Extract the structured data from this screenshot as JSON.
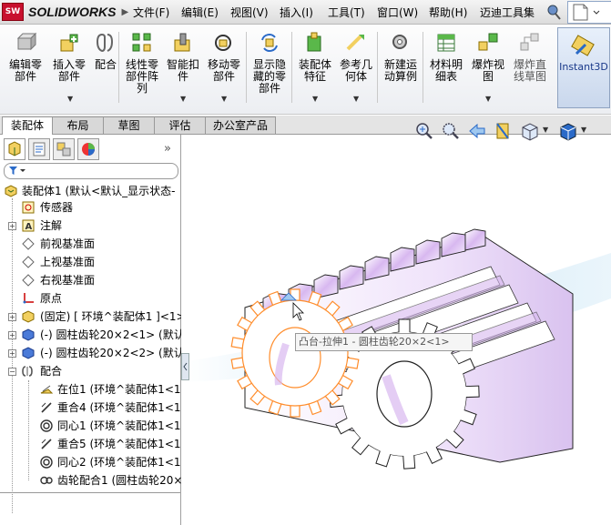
{
  "app": {
    "brand": "SOLIDWORKS",
    "brand_icon": "solidworks-logo-icon"
  },
  "menubar": {
    "items": [
      "文件(F)",
      "编辑(E)",
      "视图(V)",
      "插入(I)",
      "工具(T)",
      "窗口(W)",
      "帮助(H)",
      "迈迪工具集"
    ]
  },
  "ribbon": {
    "buttons": [
      {
        "label": "编辑零\n部件",
        "icon": "edit-component-icon"
      },
      {
        "label": "插入零\n部件",
        "icon": "insert-component-icon"
      },
      {
        "label": "配合",
        "icon": "mate-icon"
      },
      {
        "label": "线性零\n部件阵\n列",
        "icon": "linear-pattern-icon"
      },
      {
        "label": "智能扣\n件",
        "icon": "smart-fastener-icon"
      },
      {
        "label": "移动零\n部件",
        "icon": "move-component-icon"
      },
      {
        "label": "显示隐\n藏的零\n部件",
        "icon": "show-hidden-icon"
      },
      {
        "label": "装配体\n特征",
        "icon": "assembly-feature-icon"
      },
      {
        "label": "参考几\n何体",
        "icon": "reference-geometry-icon"
      },
      {
        "label": "新建运\n动算例",
        "icon": "motion-study-icon"
      },
      {
        "label": "材料明\n细表",
        "icon": "bom-icon"
      },
      {
        "label": "爆炸视\n图",
        "icon": "exploded-view-icon"
      },
      {
        "label": "爆炸直\n线草图",
        "icon": "explode-line-sketch-icon"
      },
      {
        "label": "Instant3D",
        "icon": "instant3d-icon"
      }
    ]
  },
  "tabs": [
    "装配体",
    "布局",
    "草图",
    "评估",
    "办公室产品"
  ],
  "tree": {
    "root": "装配体1  (默认<默认_显示状态-",
    "items": [
      {
        "label": "传感器",
        "icon": "sensor-icon"
      },
      {
        "label": "注解",
        "icon": "annotation-icon"
      },
      {
        "label": "前视基准面",
        "icon": "plane-icon"
      },
      {
        "label": "上视基准面",
        "icon": "plane-icon"
      },
      {
        "label": "右视基准面",
        "icon": "plane-icon"
      },
      {
        "label": "原点",
        "icon": "origin-icon"
      },
      {
        "label": "(固定) [ 环境^装配体1 ]<1>",
        "icon": "part-icon"
      },
      {
        "label": "(-) 圆柱齿轮20×2<1> (默认",
        "icon": "part-icon"
      },
      {
        "label": "(-) 圆柱齿轮20×2<2> (默认",
        "icon": "part-icon"
      },
      {
        "label": "配合",
        "icon": "mates-folder-icon"
      },
      {
        "label": "在位1 (环境^装配体1<1",
        "icon": "inplace-mate-icon"
      },
      {
        "label": "重合4 (环境^装配体1<1",
        "icon": "coincident-mate-icon"
      },
      {
        "label": "同心1 (环境^装配体1<1",
        "icon": "concentric-mate-icon"
      },
      {
        "label": "重合5 (环境^装配体1<1",
        "icon": "coincident-mate-icon"
      },
      {
        "label": "同心2 (环境^装配体1<1",
        "icon": "concentric-mate-icon"
      },
      {
        "label": "齿轮配合1 (圆柱齿轮20×",
        "icon": "gear-mate-icon"
      }
    ]
  },
  "viewport": {
    "tooltip": "凸台-拉伸1 - 圆柱齿轮20×2<1>"
  },
  "colors": {
    "accent": "#c8102e",
    "selection": "#ff8c2a",
    "gear_face": "#d8b8f0",
    "background_swoosh": "#cfe8f6"
  }
}
